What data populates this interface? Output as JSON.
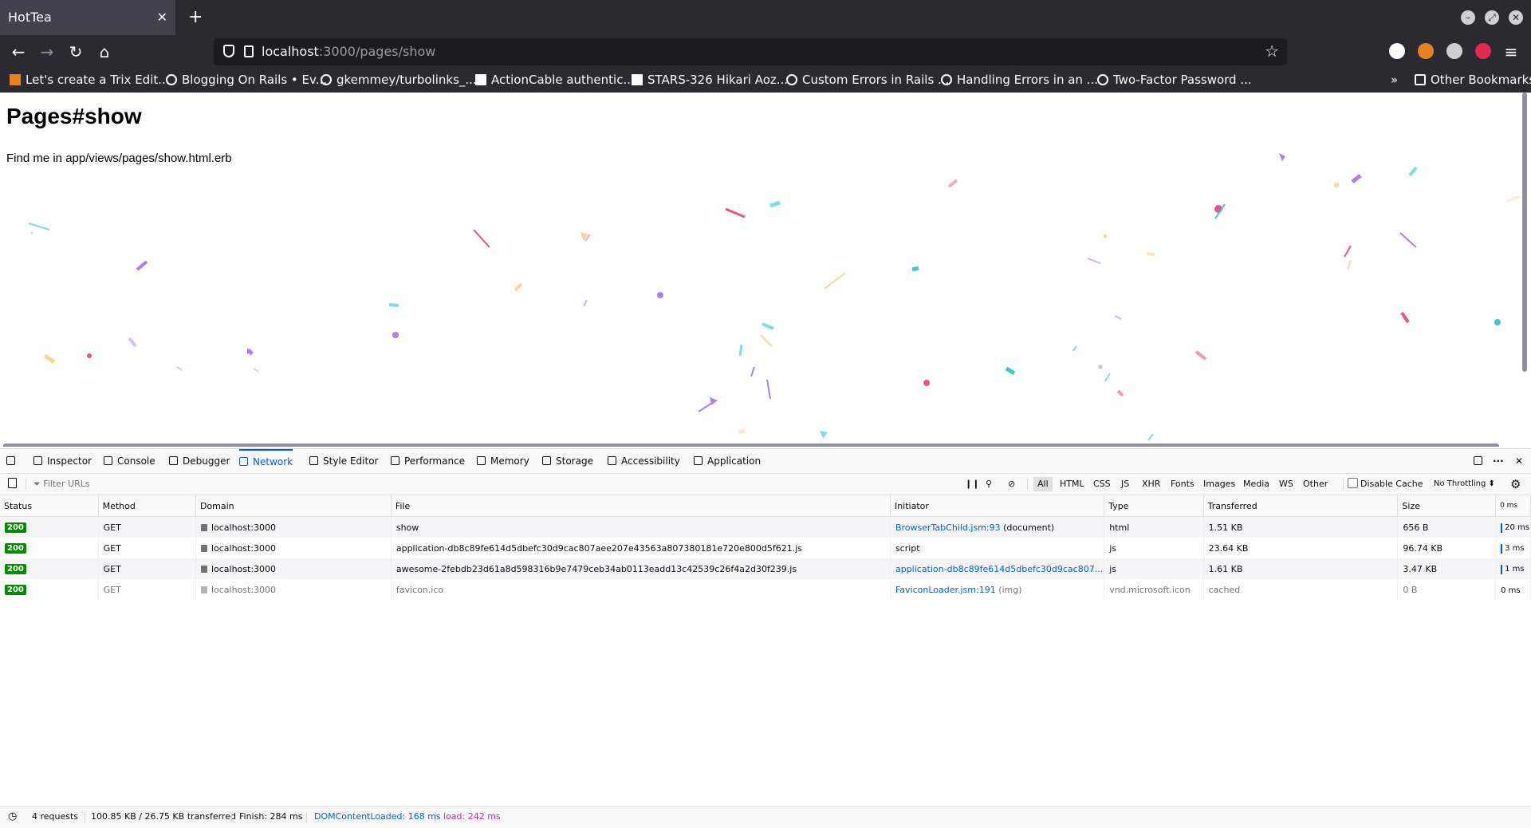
{
  "browser": {
    "tab_title": "HotTea",
    "url_host": "localhost",
    "url_path": ":3000/pages/show",
    "bookmarks": [
      "Let's create a Trix Edit...",
      "Blogging On Rails • Ev...",
      "gkemmey/turbolinks_...",
      "ActionCable authentic...",
      "STARS-326 Hikari Aoz...",
      "Custom Errors in Rails ...",
      "Handling Errors in an ...",
      "Two-Factor Password ..."
    ],
    "other_bookmarks": "Other Bookmarks"
  },
  "page": {
    "heading": "Pages#show",
    "text": "Find me in app/views/pages/show.html.erb"
  },
  "devtools": {
    "tabs": [
      "Inspector",
      "Console",
      "Debugger",
      "Network",
      "Style Editor",
      "Performance",
      "Memory",
      "Storage",
      "Accessibility",
      "Application"
    ],
    "active_tab": "Network",
    "filter_placeholder": "Filter URLs",
    "type_filters": [
      "All",
      "HTML",
      "CSS",
      "JS",
      "XHR",
      "Fonts",
      "Images",
      "Media",
      "WS",
      "Other"
    ],
    "disable_cache_label": "Disable Cache",
    "throttling_label": "No Throttling ⬍",
    "columns": [
      "Status",
      "Method",
      "Domain",
      "File",
      "Initiator",
      "Type",
      "Transferred",
      "Size",
      "0 ms"
    ],
    "rows": [
      {
        "status": "200",
        "method": "GET",
        "domain": "localhost:3000",
        "file": "show",
        "initiator_link": "BrowserTabChild.jsm:93",
        "initiator_note": " (document)",
        "type": "html",
        "transferred": "1.51 KB",
        "size": "656 B",
        "time": "20 ms"
      },
      {
        "status": "200",
        "method": "GET",
        "domain": "localhost:3000",
        "file": "application-db8c89fe614d5dbefc30d9cac807aee207e43563a807380181e720e800d5f621.js",
        "initiator_link": "",
        "initiator_note": "script",
        "type": "js",
        "transferred": "23.64 KB",
        "size": "96.74 KB",
        "time": "3 ms"
      },
      {
        "status": "200",
        "method": "GET",
        "domain": "localhost:3000",
        "file": "awesome-2febdb23d61a8d598316b9e7479ceb34ab0113eadd13c42539c26f4a2d30f239.js",
        "initiator_link": "application-db8c89fe614d5dbefc30d9cac807...",
        "initiator_note": "",
        "type": "js",
        "transferred": "1.61 KB",
        "size": "3.47 KB",
        "time": "1 ms"
      },
      {
        "status": "200",
        "method": "GET",
        "domain": "localhost:3000",
        "file": "favicon.ico",
        "initiator_link": "FaviconLoader.jsm:191",
        "initiator_note": " (img)",
        "type": "vnd.microsoft.icon",
        "transferred": "cached",
        "size": "0 B",
        "time": "0 ms"
      }
    ],
    "status": {
      "requests": "4 requests",
      "transferred": "100.85 KB / 26.75 KB transferred",
      "finish": "Finish: 284 ms",
      "dom_loaded": "DOMContentLoaded: 168 ms",
      "load": "load: 242 ms"
    }
  },
  "colors": {
    "chrome_bg": "#2b2a33",
    "accent": "#0060df",
    "status_ok": "#058b00",
    "confetti": [
      "#f0508a",
      "#7fdbe8",
      "#b07cf0",
      "#fcd48a",
      "#3ac6d8"
    ]
  }
}
